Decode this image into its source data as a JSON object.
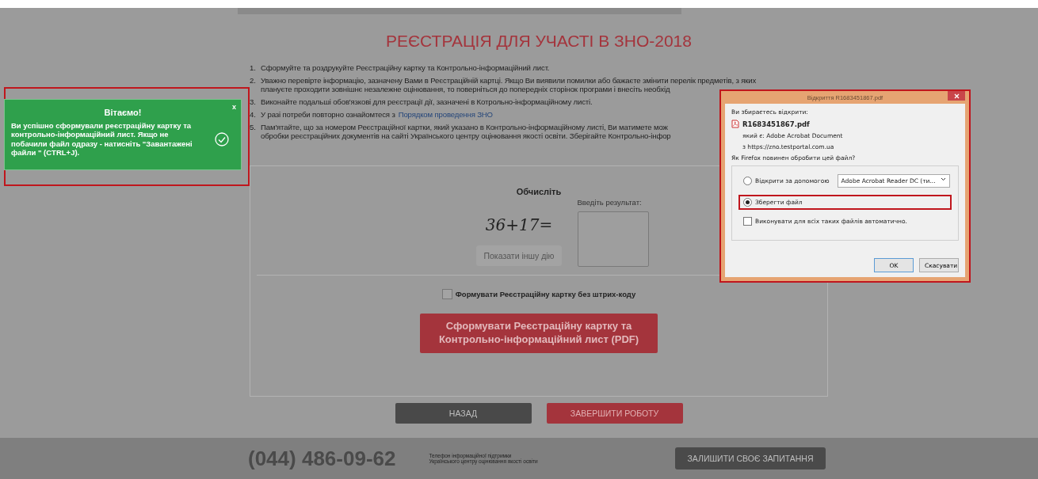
{
  "title": "РЕЄСТРАЦІЯ ДЛЯ УЧАСТІ В ЗНО-2018",
  "steps": [
    {
      "number": "1.",
      "lines": [
        "Сформуйте та роздрукуйте Реєстраційну картку та Контрольно-інформаційний лист."
      ]
    },
    {
      "number": "2.",
      "lines": [
        "Уважно перевірте інформацію, зазначену Вами в Реєстраційній картці. Якщо Ви виявили помилки або бажаєте змінити перелік предметів, з яких",
        "плануєте проходити зовнішнє незалежне оцінювання, то поверніться до попередніх сторінок програми і внесіть необхід"
      ]
    },
    {
      "number": "3.",
      "lines": [
        "Виконайте подальші обов'язкові для реєстрації дії, зазначені в Котрольно-інформаційному листі."
      ]
    },
    {
      "number": "4.",
      "lines": [
        "У разі потреби повторно ознайомтеся з "
      ],
      "link": "Порядком проведення ЗНО"
    },
    {
      "number": "5.",
      "lines": [
        "Пам'ятайте, що за номером Реєстраційної картки, який указано в Контрольно-інформаційному листі, Ви матимете мож",
        "обробки реєстраційних документів на сайті Українського центру оцінювання якості освіти. Зберігайте Контрольно-інфор"
      ]
    }
  ],
  "captcha": {
    "heading": "Обчисліть",
    "expression": "36+17=",
    "refresh_button": "Показати іншу дію",
    "result_label": "Введіть результат:"
  },
  "no_barcode": {
    "label": "Формувати Реєстраційну картку без штрих-коду",
    "checked": false
  },
  "generate_button": "Сформувати Реєстраційну картку та Контрольно-інформаційний лист (PDF)",
  "nav_buttons": [
    {
      "label": "НАЗАД",
      "kind": "secondary"
    },
    {
      "label": "ЗАВЕРШИТИ РОБОТУ",
      "kind": "primary"
    }
  ],
  "footer": {
    "phone": "(044) 486-09-62",
    "support_lines": [
      "Телефон інформаційної підтримки",
      "Українського центру оцінювання якості освіти"
    ],
    "question_button": "ЗАЛИШИТИ СВОЄ ЗАПИТАННЯ"
  },
  "toast": {
    "title": "Вітаємо!",
    "close": "x",
    "message": "Ви успішно сформували реєстраційну картку та контрольно-інформаційний лист. Якщо не побачили файл одразу - натисніть \"Завантажені файли \" (CTRL+J)."
  },
  "dialog": {
    "title": "Відкриття R1683451867.pdf",
    "intro": "Ви збираєтесь відкрити:",
    "filename": "R1683451867.pdf",
    "type_label": "який є:",
    "type": "Adobe Acrobat Document",
    "source": "з https://zno.testportal.com.ua",
    "question": "Як Firefox повинен обробити цей файл?",
    "options": [
      {
        "label": "Відкрити за допомогою",
        "selected": false,
        "app": "Adobe Acrobat Reader DC  (ти..."
      },
      {
        "label": "Зберегти файл",
        "selected": true
      }
    ],
    "auto": {
      "label": "Виконувати для всіх таких файлів автоматично.",
      "checked": false
    },
    "buttons": [
      "OK",
      "Скасувати"
    ]
  }
}
